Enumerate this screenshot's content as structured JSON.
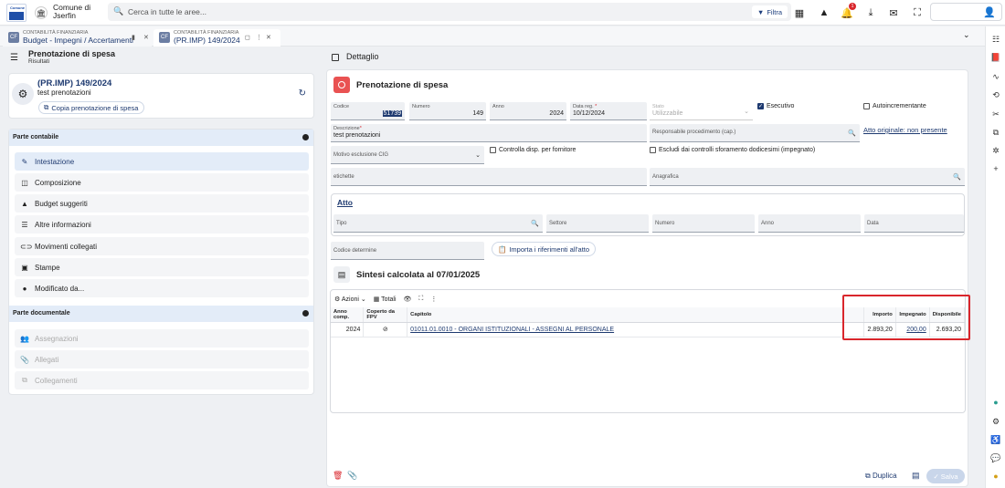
{
  "topbar": {
    "logo_text": "Comune",
    "town": "Comune di\nJserfin",
    "search_placeholder": "Cerca in tutte le aree...",
    "filter_label": "Filtra",
    "notifications_count": "1"
  },
  "tabs": [
    {
      "module": "CONTABILITÀ FINANZIARIA",
      "label": "Budget - Impegni / Accertamenti"
    },
    {
      "module": "CONTABILITÀ FINANZIARIA",
      "label": "(PR.IMP) 149/2024"
    }
  ],
  "left": {
    "title": "Prenotazione di spesa",
    "subtitle": "Risultati",
    "record_title": "(PR.IMP) 149/2024",
    "record_subtitle": "test prenotazioni",
    "copy_label": "Copia prenotazione di spesa",
    "section1": "Parte contabile",
    "nav1": [
      "Intestazione",
      "Composizione",
      "Budget suggeriti",
      "Altre informazioni",
      "Movimenti collegati",
      "Stampe",
      "Modificato da..."
    ],
    "section2": "Parte documentale",
    "nav2": [
      "Assegnazioni",
      "Allegati",
      "Collegamenti"
    ]
  },
  "right": {
    "header": "Dettaglio",
    "title": "Prenotazione di spesa",
    "fields": {
      "codice_label": "Codice",
      "codice_value": "51739",
      "numero_label": "Numero",
      "numero_value": "149",
      "anno_label": "Anno",
      "anno_value": "2024",
      "datareg_label": "Data reg.",
      "datareg_value": "10/12/2024",
      "stato_label": "Stato",
      "stato_value": "Utilizzabile",
      "esecutivo": "Esecutivo",
      "autoincrementante": "Autoincrementante",
      "descrizione_label": "Descrizione",
      "descrizione_value": "test prenotazioni",
      "responsabile_label": "Responsabile procedimento (cap.)",
      "atto_originale": "Atto originale: non presente",
      "motivo_label": "Motivo esclusione CIG",
      "controlla": "Controlla disp. per fornitore",
      "escludi": "Escludi dai controlli sforamento dodicesimi (impegnato)",
      "etichette_label": "etichette",
      "anagrafica_label": "Anagrafica"
    },
    "atto": {
      "title": "Atto",
      "tipo": "Tipo",
      "settore": "Settore",
      "numero": "Numero",
      "anno": "Anno",
      "data": "Data"
    },
    "codice_determina": "Codice determine",
    "importa_label": "Importa i riferimenti all'atto",
    "sintesi_title": "Sintesi calcolata al 07/01/2025",
    "grid_toolbar": {
      "azioni": "Azioni",
      "totali": "Totali"
    },
    "grid_headers": [
      "Anno comp.",
      "Coperto da FPV",
      "Capitolo",
      "Importo",
      "Impegnato",
      "Disponibile"
    ],
    "grid_rows": [
      {
        "anno": "2024",
        "fpv": "⊘",
        "capitolo": "01011.01.0010 - ORGANI ISTITUZIONALI - ASSEGNI AL PERSONALE",
        "importo": "2.893,20",
        "impegnato": "200,00",
        "disponibile": "2.693,20"
      }
    ],
    "duplica_label": "Duplica",
    "salva_label": "Salva"
  },
  "colors": {
    "accent": "#1e3a70",
    "danger": "#d9262c",
    "section_bg": "#e3ecf8"
  }
}
